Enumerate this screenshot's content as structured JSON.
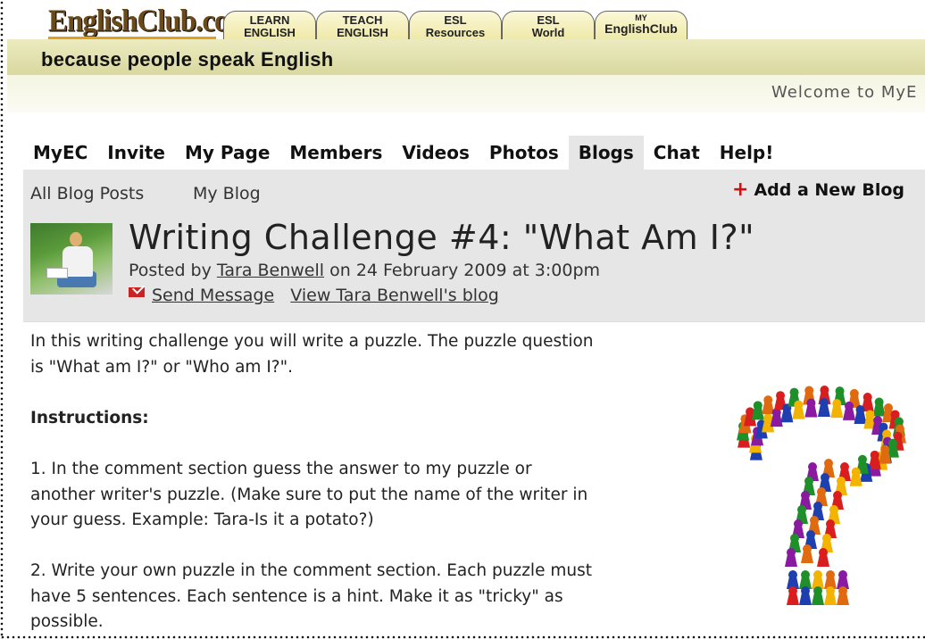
{
  "header": {
    "logo": "EnglishClub.com",
    "tabs": [
      {
        "line1": "LEARN",
        "line2": "ENGLISH"
      },
      {
        "line1": "TEACH",
        "line2": "ENGLISH"
      },
      {
        "line1": "ESL",
        "line2": "Resources"
      },
      {
        "line1": "ESL",
        "line2": "World"
      },
      {
        "line1": "MY",
        "line2": "EnglishClub"
      }
    ],
    "tagline": "because people speak English",
    "welcome": "Welcome to MyE"
  },
  "nav": {
    "items": [
      "MyEC",
      "Invite",
      "My Page",
      "Members",
      "Videos",
      "Photos",
      "Blogs",
      "Chat",
      "Help!"
    ],
    "active": "Blogs"
  },
  "subnav": {
    "all_posts": "All Blog Posts",
    "my_blog": "My Blog",
    "add_blog": "Add a New Blog"
  },
  "post": {
    "title": "Writing Challenge #4: \"What Am I?\"",
    "posted_by_prefix": "Posted by",
    "author": "Tara Benwell",
    "date": "on 24 February 2009 at 3:00pm",
    "send_message": "Send Message",
    "view_blog": "View Tara Benwell's blog"
  },
  "body": {
    "p1_line1": "In this writing challenge you will write a puzzle. The puzzle question",
    "p1_line2": "is \"What am I?\" or \"Who am I?\".",
    "instructions": "Instructions:",
    "p2_line1": "1. In the comment section guess the answer to my puzzle or",
    "p2_line2": "another writer's puzzle. (Make sure to put the name of the writer in",
    "p2_line3": "your guess. Example: Tara-Is it a potato?)",
    "p3_line1": "2. Write your own puzzle in the comment section. Each puzzle must",
    "p3_line2": "have 5 sentences. Each sentence is a hint. Make it as \"tricky\" as",
    "p3_line3": "possible."
  },
  "colors": {
    "tagline_bar": "#dcdba5",
    "nav_active": "#e6e6e6",
    "plus": "#cc1111"
  }
}
